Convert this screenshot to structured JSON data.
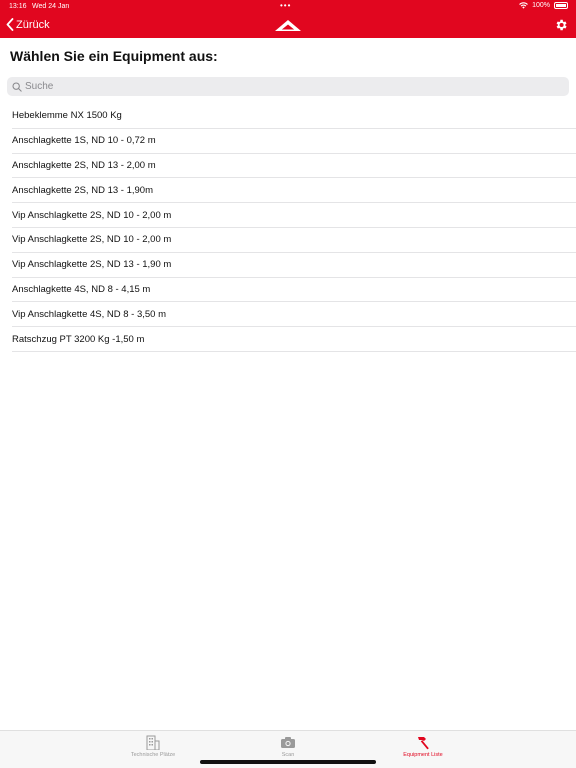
{
  "status": {
    "time": "13:16",
    "date": "Wed 24 Jan",
    "battery": "100%"
  },
  "nav": {
    "back_label": "Zürück",
    "accent_color": "#e1061f"
  },
  "page": {
    "title": "Wählen Sie ein Equipment aus:"
  },
  "search": {
    "placeholder": "Suche",
    "value": ""
  },
  "equipment": [
    "Hebeklemme NX 1500 Kg",
    "Anschlagkette 1S, ND 10 - 0,72 m",
    "Anschlagkette 2S, ND 13 - 2,00 m",
    "Anschlagkette 2S, ND 13 - 1,90m",
    "Vip Anschlagkette 2S, ND 10 - 2,00 m",
    "Vip Anschlagkette 2S, ND 10 - 2,00 m",
    "Vip Anschlagkette 2S, ND 13 - 1,90 m",
    "Anschlagkette 4S, ND 8 - 4,15 m",
    "Vip Anschlagkette 4S, ND 8 - 3,50 m",
    "Ratschzug PT 3200 Kg -1,50 m"
  ],
  "tabs": [
    {
      "label": "Technische Plätze",
      "icon": "building-icon",
      "active": false
    },
    {
      "label": "Scan",
      "icon": "camera-icon",
      "active": false
    },
    {
      "label": "Equipment Liste",
      "icon": "hammer-icon",
      "active": true
    }
  ]
}
